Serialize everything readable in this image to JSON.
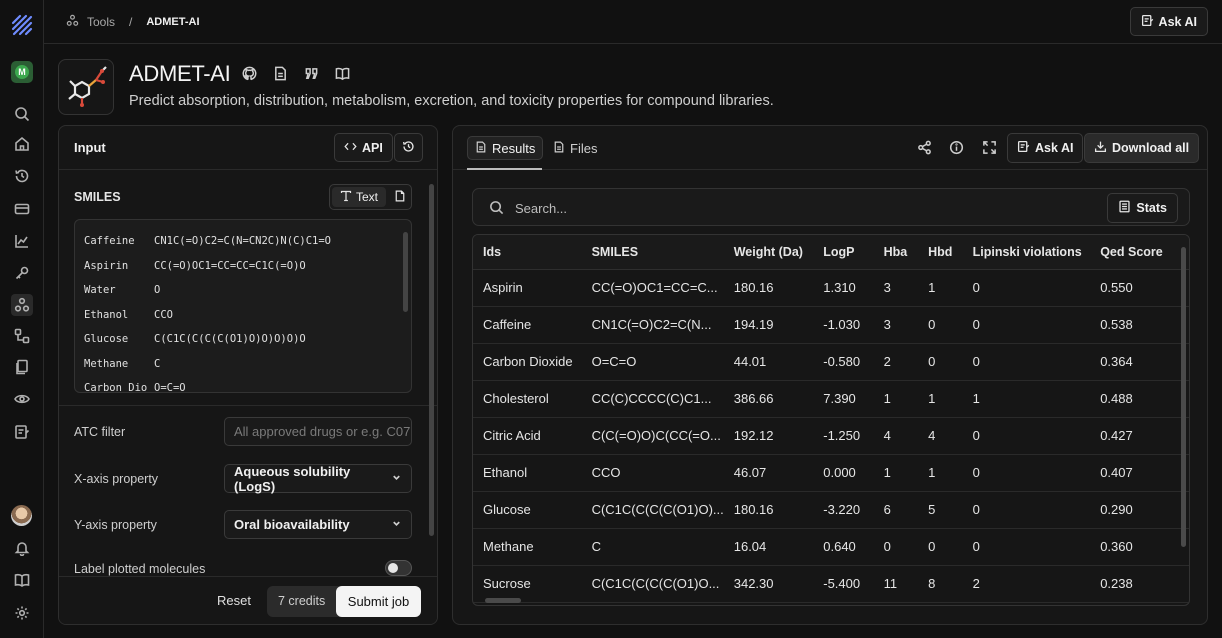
{
  "breadcrumb": {
    "root": "Tools",
    "separator": "/",
    "current": "ADMET-AI"
  },
  "top_ask_ai": "Ask AI",
  "workspace_initial": "M",
  "tool": {
    "title": "ADMET-AI",
    "subtitle": "Predict absorption, distribution, metabolism, excretion, and toxicity properties for compound libraries."
  },
  "input_panel": {
    "title": "Input",
    "api_label": "API",
    "smiles_label": "SMILES",
    "text_mode_label": "Text",
    "smiles_rows": [
      {
        "name": "Caffeine",
        "smiles": "CN1C(=O)C2=C(N=CN2C)N(C)C1=O"
      },
      {
        "name": "Aspirin",
        "smiles": "CC(=O)OC1=CC=CC=C1C(=O)O"
      },
      {
        "name": "Water",
        "smiles": "O"
      },
      {
        "name": "Ethanol",
        "smiles": "CCO"
      },
      {
        "name": "Glucose",
        "smiles": "C(C1C(C(C(C(O1)O)O)O)O)O"
      },
      {
        "name": "Methane",
        "smiles": "C"
      },
      {
        "name": "Carbon Dio",
        "smiles": "O=C=O"
      }
    ],
    "atc_label": "ATC filter",
    "atc_placeholder": "All approved drugs or e.g. C07",
    "x_axis_label": "X-axis property",
    "x_axis_value": "Aqueous solubility (LogS)",
    "y_axis_label": "Y-axis property",
    "y_axis_value": "Oral bioavailability",
    "label_plotted": "Label plotted molecules",
    "label_plotted_on": false,
    "reset_label": "Reset",
    "credits_label": "7 credits",
    "submit_label": "Submit job"
  },
  "results_panel": {
    "tabs": [
      "Results",
      "Files"
    ],
    "active_tab": "Results",
    "ask_ai_label": "Ask AI",
    "download_label": "Download all",
    "search_placeholder": "Search...",
    "stats_label": "Stats",
    "columns": [
      "Ids",
      "SMILES",
      "Weight (Da)",
      "LogP",
      "Hba",
      "Hbd",
      "Lipinski violations",
      "Qed Score"
    ],
    "rows": [
      [
        "Aspirin",
        "CC(=O)OC1=CC=C...",
        "180.16",
        "1.310",
        "3",
        "1",
        "0",
        "0.550"
      ],
      [
        "Caffeine",
        "CN1C(=O)C2=C(N...",
        "194.19",
        "-1.030",
        "3",
        "0",
        "0",
        "0.538"
      ],
      [
        "Carbon Dioxide",
        "O=C=O",
        "44.01",
        "-0.580",
        "2",
        "0",
        "0",
        "0.364"
      ],
      [
        "Cholesterol",
        "CC(C)CCCC(C)C1...",
        "386.66",
        "7.390",
        "1",
        "1",
        "1",
        "0.488"
      ],
      [
        "Citric Acid",
        "C(C(=O)O)C(CC(=O...",
        "192.12",
        "-1.250",
        "4",
        "4",
        "0",
        "0.427"
      ],
      [
        "Ethanol",
        "CCO",
        "46.07",
        "0.000",
        "1",
        "1",
        "0",
        "0.407"
      ],
      [
        "Glucose",
        "C(C1C(C(C(C(O1)O)...",
        "180.16",
        "-3.220",
        "6",
        "5",
        "0",
        "0.290"
      ],
      [
        "Methane",
        "C",
        "16.04",
        "0.640",
        "0",
        "0",
        "0",
        "0.360"
      ],
      [
        "Sucrose",
        "C(C1C(C(C(C(O1)O...",
        "342.30",
        "-5.400",
        "11",
        "8",
        "2",
        "0.238"
      ]
    ]
  }
}
